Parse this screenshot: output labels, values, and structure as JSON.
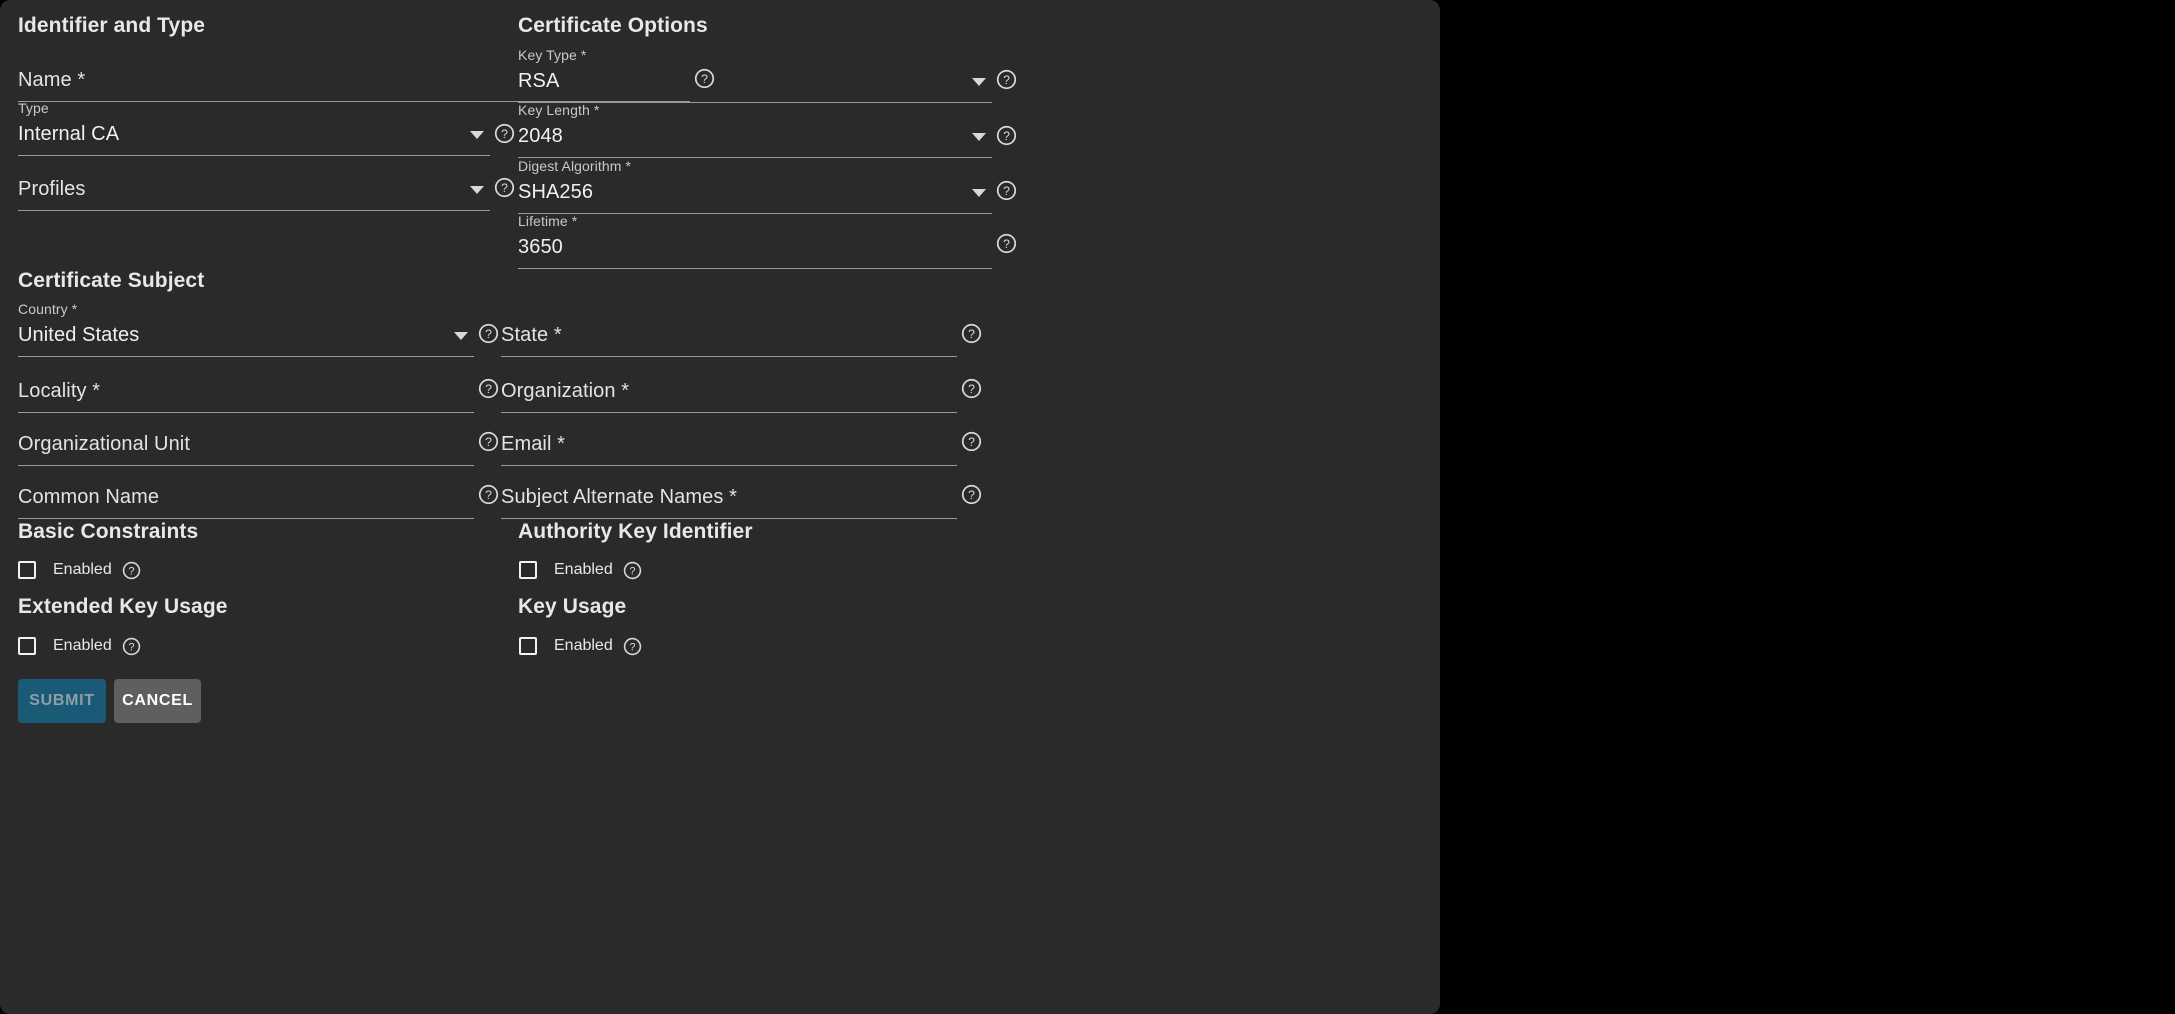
{
  "panel": {
    "background": "#2a2a2a",
    "page_background": "#000000"
  },
  "sections": {
    "identifier_and_type": {
      "title": "Identifier and Type",
      "fields": [
        {
          "label": "Name *",
          "value": "",
          "kind": "text"
        },
        {
          "label": "Type",
          "value": "Internal CA",
          "kind": "select"
        },
        {
          "label": "Profiles",
          "value": "",
          "kind": "select"
        }
      ]
    },
    "certificate_options": {
      "title": "Certificate Options",
      "fields": [
        {
          "label": "Key Type *",
          "value": "RSA",
          "kind": "select"
        },
        {
          "label": "Key Length *",
          "value": "2048",
          "kind": "select"
        },
        {
          "label": "Digest Algorithm *",
          "value": "SHA256",
          "kind": "select"
        },
        {
          "label": "Lifetime *",
          "value": "3650",
          "kind": "text"
        }
      ]
    },
    "certificate_subject": {
      "title": "Certificate Subject",
      "left_fields": [
        {
          "label": "Country *",
          "value": "United States",
          "kind": "select"
        },
        {
          "label": "Locality *",
          "value": "",
          "kind": "text"
        },
        {
          "label": "Organizational Unit",
          "value": "",
          "kind": "text"
        },
        {
          "label": "Common Name",
          "value": "",
          "kind": "text"
        }
      ],
      "right_fields": [
        {
          "label": "State *",
          "value": "",
          "kind": "text"
        },
        {
          "label": "Organization *",
          "value": "",
          "kind": "text"
        },
        {
          "label": "Email *",
          "value": "",
          "kind": "text"
        },
        {
          "label": "Subject Alternate Names *",
          "value": "",
          "kind": "text"
        }
      ]
    },
    "basic_constraints": {
      "title": "Basic Constraints",
      "checkbox_label": "Enabled",
      "checked": false
    },
    "authority_key_identifier": {
      "title": "Authority Key Identifier",
      "checkbox_label": "Enabled",
      "checked": false
    },
    "extended_key_usage": {
      "title": "Extended Key Usage",
      "checkbox_label": "Enabled",
      "checked": false
    },
    "key_usage": {
      "title": "Key Usage",
      "checkbox_label": "Enabled",
      "checked": false
    }
  },
  "actions": {
    "submit_label": "SUBMIT",
    "submit_color": "#1b5a77",
    "submit_text_color": "#8e9ea6",
    "submit_disabled": true,
    "cancel_label": "CANCEL",
    "cancel_color": "#5f5f5f",
    "cancel_text_color": "#ffffff"
  },
  "icons": {
    "help": "help-circle-icon",
    "dropdown": "chevron-down-icon",
    "checkbox": "checkbox-icon"
  }
}
